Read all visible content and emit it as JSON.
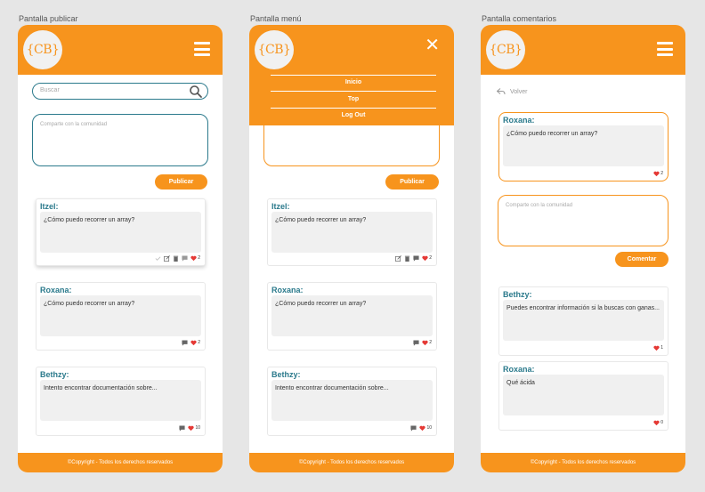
{
  "frames": [
    {
      "label": "Pantalla publicar",
      "search_placeholder": "Buscar",
      "compose_placeholder": "Comparte con la comunidad",
      "publish_button": "Publicar",
      "posts": [
        {
          "author": "Itzel:",
          "text": "¿Cómo puedo recorrer un array?",
          "likes": "2"
        },
        {
          "author": "Roxana:",
          "text": "¿Cómo puedo recorrer un array?",
          "likes": "2"
        },
        {
          "author": "Bethzy:",
          "text": "Intento encontrar documentación sobre...",
          "likes": "10"
        }
      ],
      "footer": "©Copyright - Todos los derechos reservados"
    },
    {
      "label": "Pantalla menú",
      "menu": [
        "Inicio",
        "Top",
        "Log Out"
      ],
      "publish_button": "Publicar",
      "posts": [
        {
          "author": "Itzel:",
          "text": "¿Cómo puedo recorrer un array?",
          "likes": "2"
        },
        {
          "author": "Roxana:",
          "text": "¿Cómo puedo recorrer un array?",
          "likes": "2"
        },
        {
          "author": "Bethzy:",
          "text": "Intento encontrar documentación sobre...",
          "likes": "10"
        }
      ],
      "footer": "©Copyright - Todos los derechos reservados"
    },
    {
      "label": "Pantalla comentarios",
      "back": "Volver",
      "original_post": {
        "author": "Roxana:",
        "text": "¿Cómo puedo recorrer un array?",
        "likes": "2"
      },
      "compose_placeholder": "Comparte con la comunidad",
      "comment_button": "Comentar",
      "comments": [
        {
          "author": "Bethzy:",
          "text": "Puedes encontrar información si la buscas con ganas...",
          "likes": "1"
        },
        {
          "author": "Roxana:",
          "text": "Qué ácida",
          "likes": "0"
        }
      ],
      "footer": "©Copyright - Todos los derechos reservados"
    }
  ],
  "logo": "{CB}",
  "colors": {
    "brand": "#f7941d",
    "accent": "#2b7a8c",
    "heart": "#e53935"
  },
  "icons": [
    "menu-icon",
    "close-icon",
    "search-icon",
    "back-arrow-icon",
    "check-icon",
    "edit-icon",
    "trash-icon",
    "comment-icon",
    "heart-icon"
  ]
}
